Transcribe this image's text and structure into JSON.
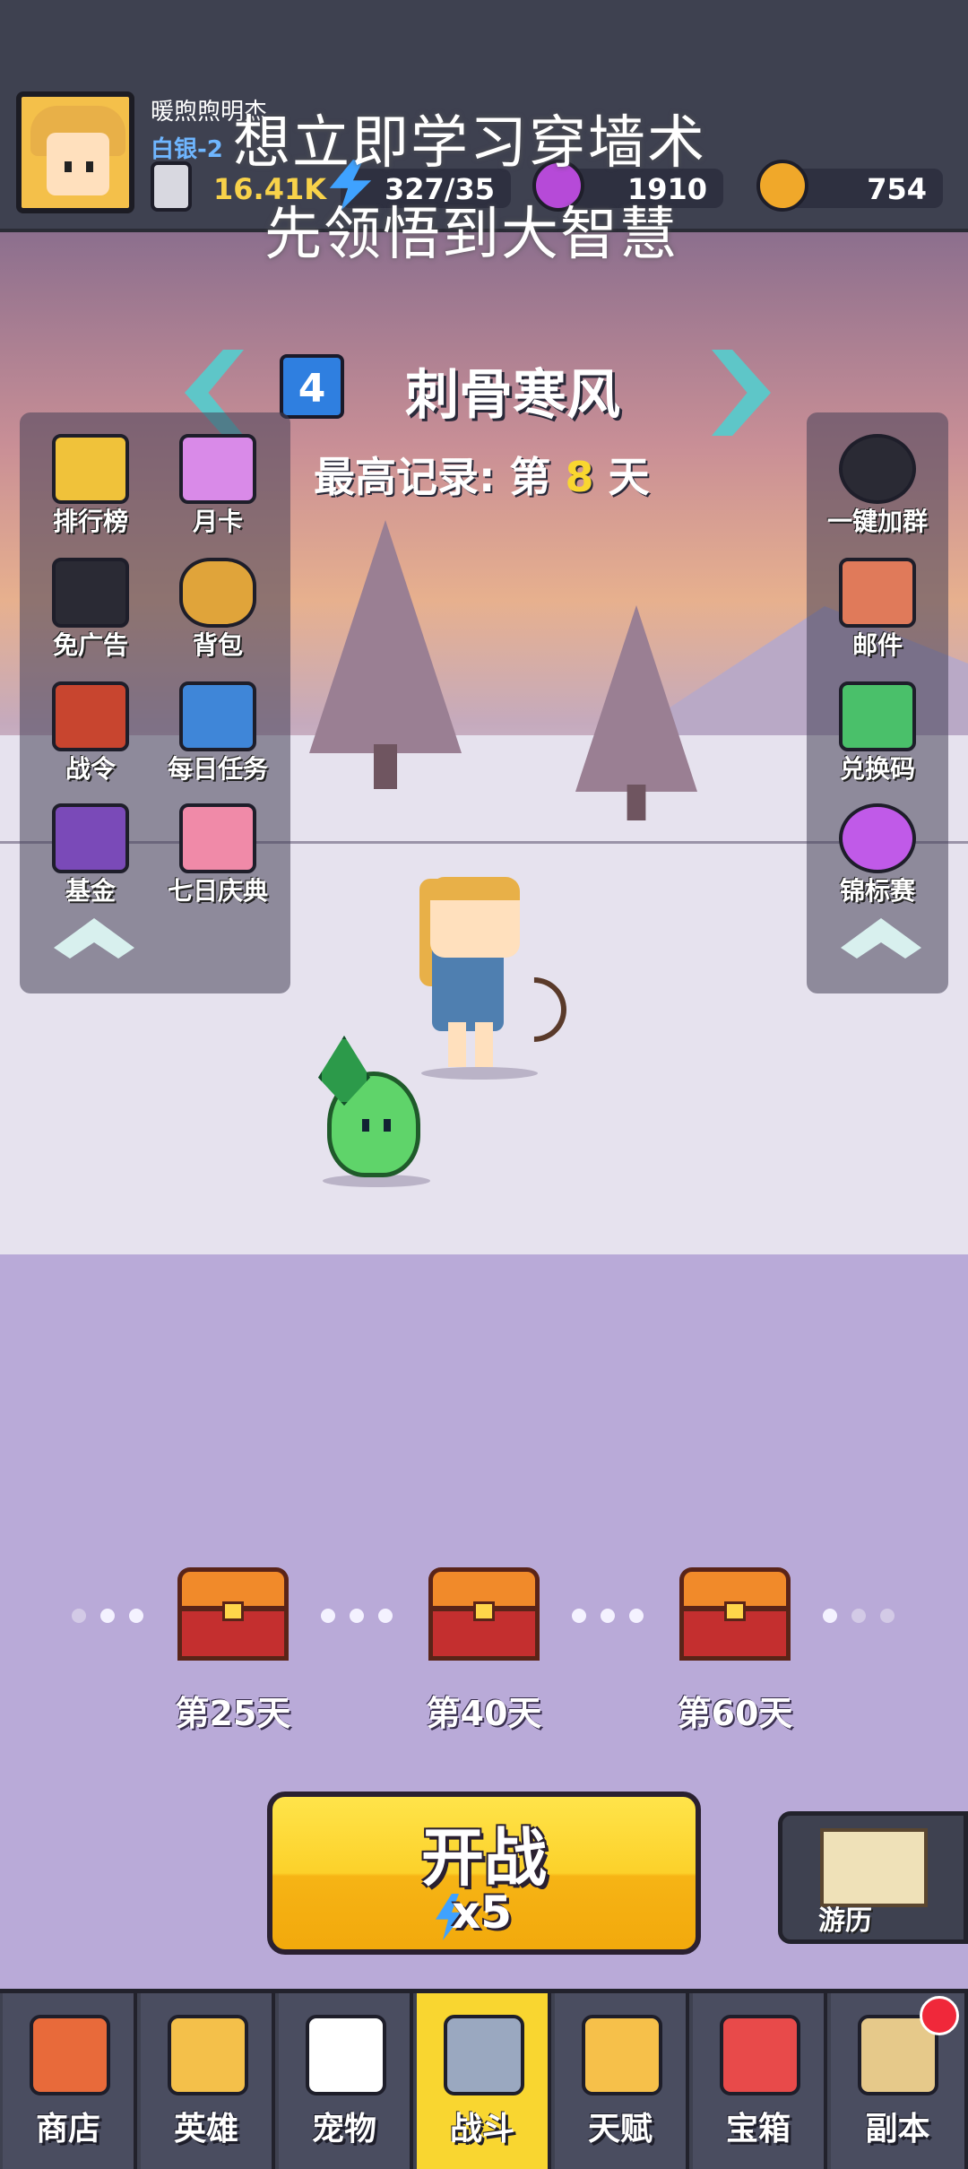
{
  "player": {
    "nickname": "暖煦煦明杰",
    "rank": "白银-2",
    "power": "16.41K"
  },
  "resources": {
    "energy": "327/35",
    "gems": "1910",
    "gold": "754"
  },
  "overlay": {
    "line1": "想立即学习穿墙术",
    "line2": "先领悟到大智慧"
  },
  "chapter": {
    "number": "4",
    "name": "刺骨寒风",
    "record_prefix": "最高记录: 第",
    "record_day": "8",
    "record_suffix": "天"
  },
  "left_menu": [
    "排行榜",
    "月卡",
    "免广告",
    "背包",
    "战令",
    "每日任务",
    "基金",
    "七日庆典"
  ],
  "right_menu": [
    "一键加群",
    "邮件",
    "兑换码",
    "锦标赛"
  ],
  "rewards": [
    {
      "label": "第25天"
    },
    {
      "label": "第40天"
    },
    {
      "label": "第60天"
    }
  ],
  "start_button": {
    "label": "开战",
    "cost": "x5"
  },
  "travel_label": "游历",
  "nav": [
    {
      "label": "商店",
      "color": "#e86a3a"
    },
    {
      "label": "英雄",
      "color": "#f4c04a"
    },
    {
      "label": "宠物",
      "color": "#ffffff"
    },
    {
      "label": "战斗",
      "color": "#9aa8c0",
      "active": true
    },
    {
      "label": "天赋",
      "color": "#f6c04a"
    },
    {
      "label": "宝箱",
      "color": "#e84a4a"
    },
    {
      "label": "副本",
      "color": "#e6c98a"
    }
  ]
}
